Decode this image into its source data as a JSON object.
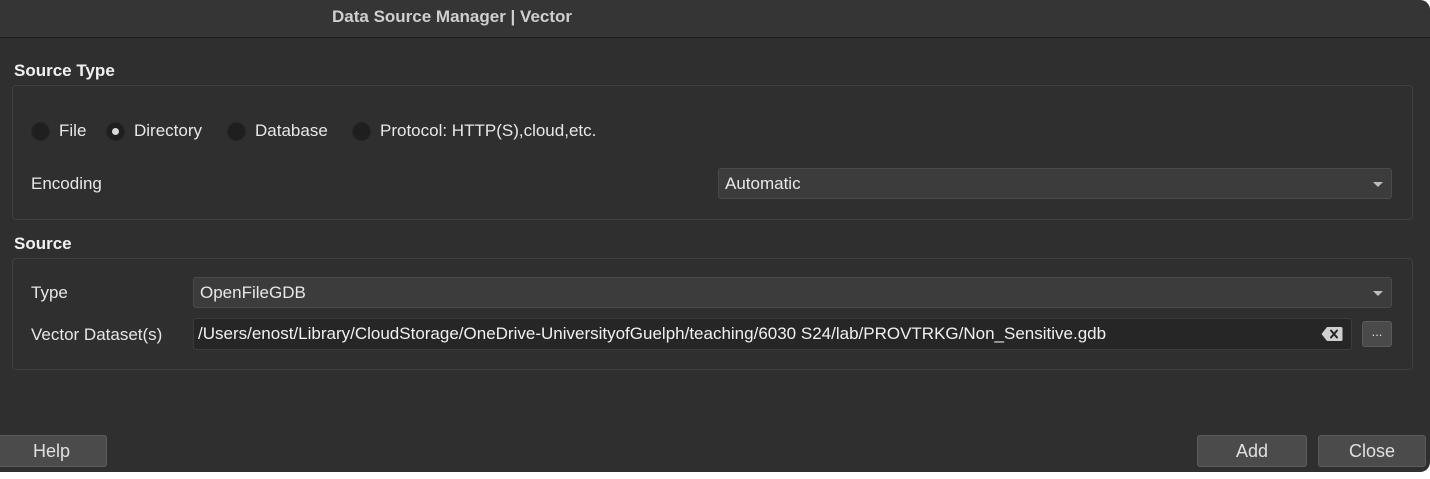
{
  "window": {
    "title": "Data Source Manager | Vector"
  },
  "source_type": {
    "heading": "Source Type",
    "radios": [
      {
        "label": "File",
        "checked": false
      },
      {
        "label": "Directory",
        "checked": true
      },
      {
        "label": "Database",
        "checked": false
      },
      {
        "label": "Protocol: HTTP(S),cloud,etc.",
        "checked": false
      }
    ],
    "encoding_label": "Encoding",
    "encoding_value": "Automatic"
  },
  "source": {
    "heading": "Source",
    "type_label": "Type",
    "type_value": "OpenFileGDB",
    "dataset_label": "Vector Dataset(s)",
    "dataset_path": "/Users/enost/Library/CloudStorage/OneDrive-UniversityofGuelph/teaching/6030 S24/lab/PROVTRKG/Non_Sensitive.gdb",
    "browse_label": "..."
  },
  "buttons": {
    "help": "Help",
    "add": "Add",
    "close": "Close"
  }
}
